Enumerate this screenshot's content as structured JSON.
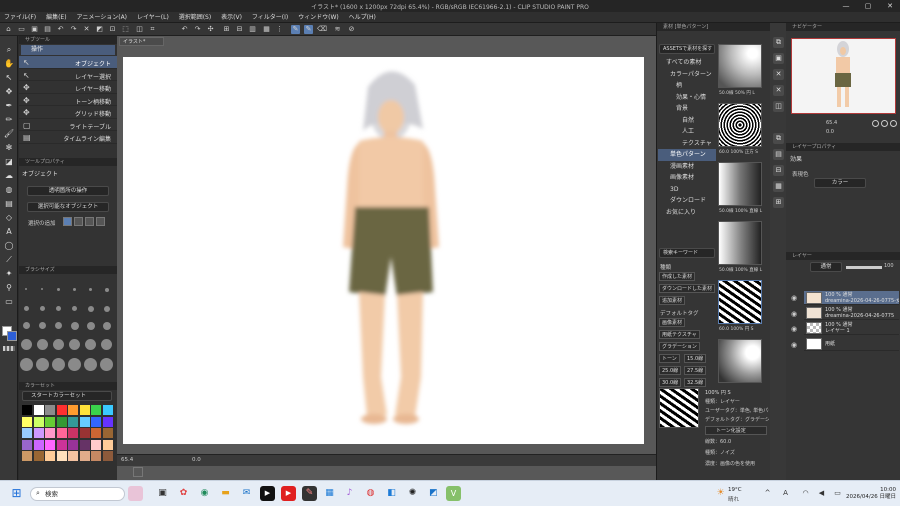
{
  "window": {
    "title": "イラスト* (1600 x 1200px 72dpi 65.4%) - RGB/sRGB IEC61966-2.1) - CLIP STUDIO PAINT PRO",
    "controls": [
      "—",
      "▢",
      "✕"
    ]
  },
  "menu": [
    "ファイル(F)",
    "編集(E)",
    "アニメーション(A)",
    "レイヤー(L)",
    "選択範囲(S)",
    "表示(V)",
    "フィルター(I)",
    "ウィンドウ(W)",
    "ヘルプ(H)"
  ],
  "sub_tool": {
    "panel_title": "サブツール",
    "tab_label": "操作",
    "items": [
      {
        "label": "オブジェクト",
        "selected": true
      },
      {
        "label": "レイヤー選択"
      },
      {
        "label": "レイヤー移動"
      },
      {
        "label": "トーン柄移動"
      },
      {
        "label": "グリッド移動"
      },
      {
        "label": "ライトテーブル"
      },
      {
        "label": "タイムライン編集"
      }
    ]
  },
  "tool_property": {
    "panel_title": "ツールプロパティ",
    "heading": "オブジェクト",
    "dropdown1": "透明箇所の操作",
    "dropdown2": "選択可能なオブジェクト",
    "label3": "選択の追加"
  },
  "brush_size": {
    "panel_title": "ブラシサイズ"
  },
  "color_set": {
    "panel_title": "カラーセット",
    "set_name": "スタートカラーセット",
    "colors": [
      "#000000",
      "#ffffff",
      "#8c8c8c",
      "#ff3030",
      "#ff9c2f",
      "#ffe23a",
      "#3ad34c",
      "#3ac9ff",
      "#ffff66",
      "#ccff66",
      "#66cc33",
      "#339933",
      "#339999",
      "#66ccff",
      "#3366ff",
      "#6633ff",
      "#99ccff",
      "#cc99ff",
      "#ff99cc",
      "#ff6699",
      "#cc3366",
      "#993333",
      "#cc6633",
      "#996633",
      "#9966cc",
      "#cc66ff",
      "#ff66ff",
      "#cc3399",
      "#993399",
      "#663366",
      "#ffcccc",
      "#ffcc99",
      "#cc9966",
      "#996633",
      "#ffcc99",
      "#ffe0bd",
      "#f4c2a1",
      "#e0ac8a",
      "#c68863",
      "#8d5a3b"
    ]
  },
  "canvas": {
    "tab_label": "イラスト*",
    "zoom": "65.4",
    "angle": "0.0"
  },
  "material": {
    "panel_title": "素材 [単色パターン]",
    "search_placeholder": "ASSETSで素材を探す",
    "tree": [
      {
        "label": "すべての素材",
        "indent": 0
      },
      {
        "label": "カラーパターン",
        "indent": 1
      },
      {
        "label": "柄",
        "indent": 2
      },
      {
        "label": "効果・心情",
        "indent": 2
      },
      {
        "label": "背景",
        "indent": 2
      },
      {
        "label": "自然",
        "indent": 3
      },
      {
        "label": "人工",
        "indent": 3
      },
      {
        "label": "テクスチャ",
        "indent": 3
      },
      {
        "label": "単色パターン",
        "indent": 1,
        "selected": true
      },
      {
        "label": "漫画素材",
        "indent": 1
      },
      {
        "label": "画像素材",
        "indent": 1
      },
      {
        "label": "3D",
        "indent": 1
      },
      {
        "label": "ダウンロード",
        "indent": 1
      },
      {
        "label": "お気に入り",
        "indent": 0
      }
    ],
    "search_keyword_placeholder": "検索キーワード",
    "kind_label": "種類",
    "tags": [
      "作成した素材",
      "ダウンロードした素材",
      "追加素材"
    ],
    "default_tag_label": "デフォルトタグ",
    "default_tags": [
      "画像素材",
      "用紙テクスチャ",
      "グラデーション",
      "トーン",
      "15.0線",
      "25.0線",
      "27.5線",
      "30.0線",
      "32.5線"
    ],
    "thumbs": [
      {
        "caption": "50.0線 50% 円 L"
      },
      {
        "caption": "60.0 100% 正方 S"
      },
      {
        "caption": "50.0線 100% 直線 L"
      },
      {
        "caption": "50.0線 100% 直線 L"
      },
      {
        "caption": "60.0 100% 円 S"
      },
      {
        "caption": "100% 円 S"
      }
    ],
    "detail": {
      "name": "100% 円 S",
      "kind": "種類：レイヤー",
      "user_tag": "ユーザータグ：単色, 単色パターン",
      "default_tag": "デフォルトタグ：グラデーション, トーン",
      "checkbox": "トーン化設定",
      "lines": "線数：60.0",
      "kind2": "種類：ノイズ",
      "density": "濃度：画像の色を使用"
    }
  },
  "navigator": {
    "panel_title": "ナビゲーター",
    "zoom": "65.4",
    "angle": "0.0"
  },
  "layer_property": {
    "panel_title": "レイヤープロパティ",
    "effect": "効果",
    "expression": "表現色",
    "expression_value": "カラー"
  },
  "layers": {
    "panel_title": "レイヤー",
    "blend": "通常",
    "opacity": "100",
    "items": [
      {
        "line1": "100 % 通常",
        "line2": "dreamina-2026-04-26-0775-女の子",
        "selected": true
      },
      {
        "line1": "100 % 通常",
        "line2": "dreamina-2026-04-26-0775"
      },
      {
        "line1": "100 % 通常",
        "line2": "レイヤー 1"
      },
      {
        "line1": "用紙",
        "line2": ""
      }
    ]
  },
  "taskbar": {
    "search": "検索",
    "weather_temp": "19°C",
    "weather_desc": "晴れ",
    "ime": "A",
    "time": "10:00",
    "date": "2026/04/26 日曜日"
  }
}
